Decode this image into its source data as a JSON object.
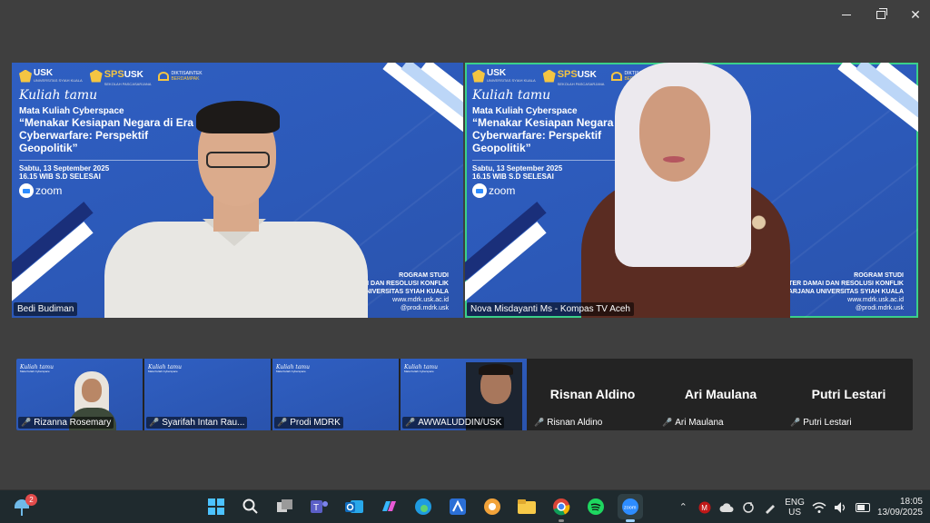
{
  "window": {
    "minimize": "minimize",
    "restore": "restore",
    "close": "close"
  },
  "slide": {
    "logo_usk": "USK",
    "logo_usk_sub": "UNIVERSITAS SYIAH KUALA",
    "logo_sps": "SPS",
    "logo_sps_usk": "USK",
    "logo_sps_sub": "SEKOLAH PASCASARJANA",
    "logo_diktis": "DIKTISAINTEK",
    "logo_diktis_sub": "BERDAMPAK",
    "kuliah": "Kuliah tamu",
    "course": "Mata Kuliah Cyberspace",
    "topic": "“Menakar Kesiapan Negara di Era Cyberwarfare: Perspektif Geopolitik”",
    "date": "Sabtu, 13 September 2025",
    "time": "16.15 WIB S.D SELESAI",
    "zoom": "zoom"
  },
  "main_tiles": [
    {
      "name": "Bedi Budiman",
      "program_lines": [
        "ROGRAM STUDI",
        "DAMAI DAN RESOLUSI KONFLIK",
        "UNIVERSITAS SYIAH KUALA"
      ],
      "site": "www.mdrk.usk.ac.id",
      "handle": "@prodi.mdrk.usk"
    },
    {
      "name": "Nova Misdayanti Ms - Kompas TV Aceh",
      "program_lines": [
        "ROGRAM STUDI",
        "MAGISTER DAMAI DAN RESOLUSI KONFLIK",
        "SEKOLAH PASCASARJANA UNIVERSITAS SYIAH KUALA"
      ],
      "site": "www.mdrk.usk.ac.id",
      "handle": "@prodi.mdrk.usk"
    }
  ],
  "gallery": [
    {
      "name": "Rizanna Rosemary",
      "type": "video"
    },
    {
      "name": "Syarifah Intan Rau...",
      "type": "video"
    },
    {
      "name": "Prodi MDRK",
      "type": "video"
    },
    {
      "name": "AWWALUDDIN/USK",
      "type": "video"
    },
    {
      "name": "Risnan Aldino",
      "type": "name"
    },
    {
      "name": "Ari Maulana",
      "type": "name"
    },
    {
      "name": "Putri Lestari",
      "type": "name"
    }
  ],
  "taskbar": {
    "weather_badge": "2",
    "lang_line1": "ENG",
    "lang_line2": "US",
    "time": "18:05",
    "date": "13/09/2025"
  },
  "colors": {
    "slide_blue": "#2f5fc2",
    "active_speaker": "#3ad08a",
    "mic_off": "#e8403a",
    "taskbar": "#1f2a2e"
  }
}
